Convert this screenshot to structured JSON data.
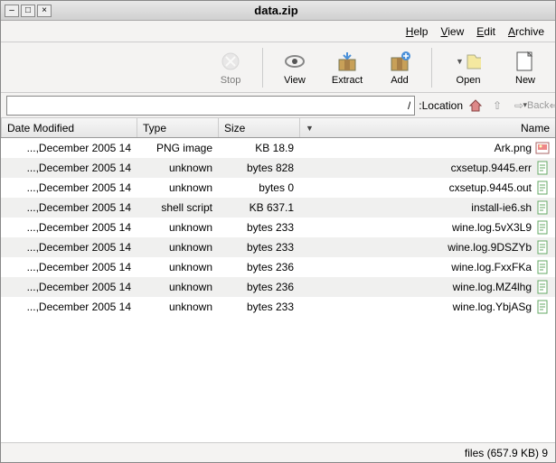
{
  "titlebar": {
    "title": "data.zip"
  },
  "menubar": {
    "archive": "Archive",
    "edit": "Edit",
    "view": "View",
    "help": "Help"
  },
  "toolbar": {
    "new": "New",
    "open": "Open",
    "add": "Add",
    "extract": "Extract",
    "view": "View",
    "stop": "Stop"
  },
  "locbar": {
    "back_label": "Back",
    "location_label": "Location:",
    "path": "/"
  },
  "columns": {
    "name": "Name",
    "size": "Size",
    "type": "Type",
    "date": "Date Modified",
    "sort_indicator": "▼"
  },
  "files": [
    {
      "icon": "image",
      "name": "Ark.png",
      "size": "18.9 KB",
      "type": "PNG image",
      "date": "14 December 2005,..."
    },
    {
      "icon": "text",
      "name": "cxsetup.9445.err",
      "size": "828 bytes",
      "type": "unknown",
      "date": "14 December 2005,..."
    },
    {
      "icon": "text",
      "name": "cxsetup.9445.out",
      "size": "0 bytes",
      "type": "unknown",
      "date": "14 December 2005,..."
    },
    {
      "icon": "text",
      "name": "install-ie6.sh",
      "size": "637.1 KB",
      "type": "shell script",
      "date": "14 December 2005,..."
    },
    {
      "icon": "text",
      "name": "wine.log.5vX3L9",
      "size": "233 bytes",
      "type": "unknown",
      "date": "14 December 2005,..."
    },
    {
      "icon": "text",
      "name": "wine.log.9DSZYb",
      "size": "233 bytes",
      "type": "unknown",
      "date": "14 December 2005,..."
    },
    {
      "icon": "text",
      "name": "wine.log.FxxFKa",
      "size": "236 bytes",
      "type": "unknown",
      "date": "14 December 2005,..."
    },
    {
      "icon": "text",
      "name": "wine.log.MZ4lhg",
      "size": "236 bytes",
      "type": "unknown",
      "date": "14 December 2005,..."
    },
    {
      "icon": "text",
      "name": "wine.log.YbjASg",
      "size": "233 bytes",
      "type": "unknown",
      "date": "14 December 2005,..."
    }
  ],
  "status": {
    "text": "9 files (657.9 KB)"
  },
  "icons": {
    "minimize": "–",
    "maximize": "□",
    "close": "×",
    "back_arrow": "⇐",
    "forward_arrow": "⇨",
    "up_arrow": "⇧"
  }
}
